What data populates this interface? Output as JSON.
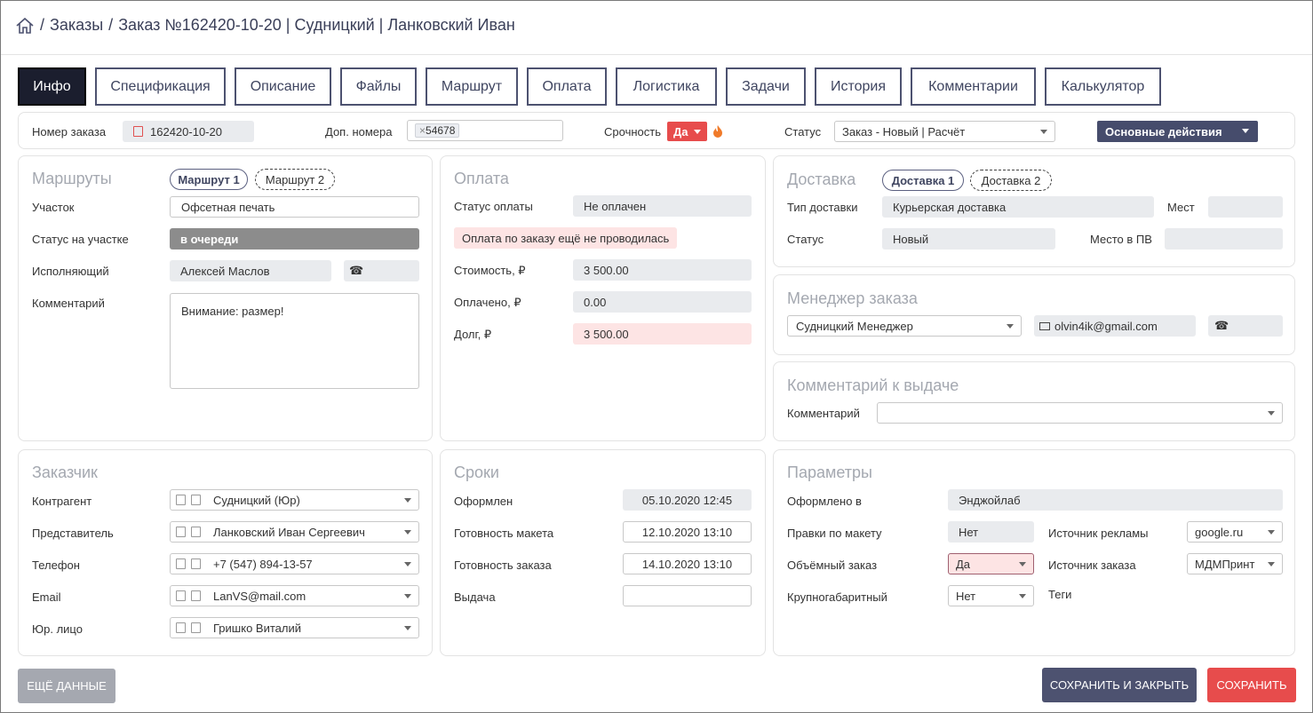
{
  "breadcrumb": {
    "orders": "Заказы",
    "order": "Заказ №162420-10-20 | Судницкий  | Ланковский Иван"
  },
  "tabs": [
    "Инфо",
    "Спецификация",
    "Описание",
    "Файлы",
    "Маршрут",
    "Оплата",
    "Логистика",
    "Задачи",
    "История",
    "Комментарии",
    "Калькулятор"
  ],
  "head": {
    "order_no_label": "Номер заказа",
    "order_no": "162420-10-20",
    "extra_label": "Доп. номера",
    "extra_tag": "54678",
    "urgency_label": "Срочность",
    "urgency": "Да",
    "status_label": "Статус",
    "status": "Заказ - Новый | Расчёт",
    "actions": "Основные действия"
  },
  "routes": {
    "title": "Маршруты",
    "pill1": "Маршрут 1",
    "pill2": "Маршрут 2",
    "section_label": "Участок",
    "section": "Офсетная печать",
    "status_label": "Статус на участке",
    "status": "в очереди",
    "exec_label": "Исполняющий",
    "exec": "Алексей Маслов",
    "comment_label": "Комментарий",
    "comment": "Внимание: размер!"
  },
  "payment": {
    "title": "Оплата",
    "status_label": "Статус оплаты",
    "status": "Не оплачен",
    "alert": "Оплата по заказу ещё не проводилась",
    "cost_label": "Стоимость, ₽",
    "cost": "3 500.00",
    "paid_label": "Оплачено, ₽",
    "paid": "0.00",
    "debt_label": "Долг, ₽",
    "debt": "3 500.00"
  },
  "delivery": {
    "title": "Доставка",
    "pill1": "Доставка 1",
    "pill2": "Доставка 2",
    "type_label": "Тип доставки",
    "type": "Курьерская доставка",
    "places_label": "Мест",
    "status_label": "Статус",
    "status": "Новый",
    "pv_label": "Место в ПВ"
  },
  "manager": {
    "title": "Менеджер заказа",
    "name": "Судницкий Менеджер",
    "email": "olvin4ik@gmail.com"
  },
  "issue": {
    "title": "Комментарий к выдаче",
    "comment_label": "Комментарий"
  },
  "customer": {
    "title": "Заказчик",
    "contractor_label": "Контрагент",
    "contractor": "Судницкий (Юр)",
    "rep_label": "Представитель",
    "rep": "Ланковский Иван Сергеевич",
    "phone_label": "Телефон",
    "phone": "+7 (547) 894-13-57",
    "email_label": "Email",
    "email": "LanVS@mail.com",
    "legal_label": "Юр. лицо",
    "legal": "Гришко Виталий"
  },
  "dates": {
    "title": "Сроки",
    "created_label": "Оформлен",
    "created": "05.10.2020 12:45",
    "layout_label": "Готовность макета",
    "layout": "12.10.2020 13:10",
    "ready_label": "Готовность заказа",
    "ready": "14.10.2020 13:10",
    "issue_label": "Выдача"
  },
  "params": {
    "title": "Параметры",
    "placed_label": "Оформлено в",
    "placed": "Энджойлаб",
    "edits_label": "Правки по макету",
    "edits": "Нет",
    "bulk_label": "Объёмный заказ",
    "bulk": "Да",
    "large_label": "Крупногабаритный",
    "large": "Нет",
    "ad_label": "Источник рекламы",
    "ad": "google.ru",
    "source_label": "Источник заказа",
    "source": "МДМПринт",
    "tags_label": "Теги"
  },
  "footer": {
    "more": "ЕЩЁ ДАННЫЕ",
    "save_close": "СОХРАНИТЬ И ЗАКРЫТЬ",
    "save": "СОХРАНИТЬ"
  }
}
